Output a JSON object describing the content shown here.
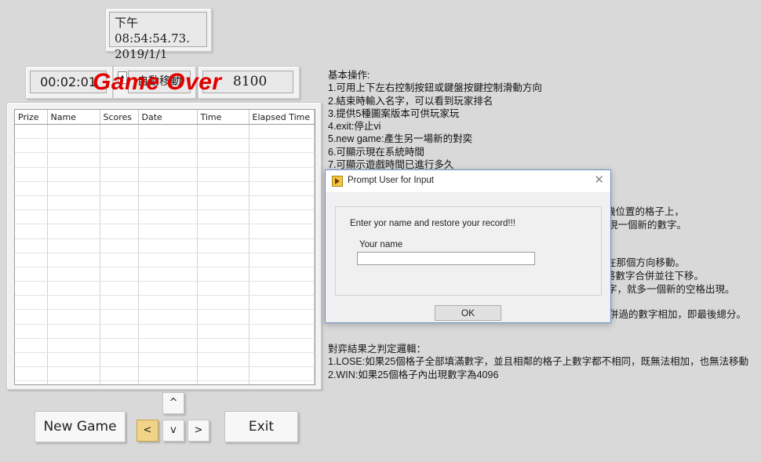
{
  "clock": {
    "time": "下午 08:54:54.73.",
    "date": "2019/1/1"
  },
  "elapsed": "00:02:01",
  "auto_move": {
    "label": "自動移動",
    "spinner": "▴"
  },
  "score": "8100",
  "status_text": "Game Over",
  "leaderboard": {
    "columns": [
      "Prize",
      "Name",
      "Scores",
      "Date",
      "Time",
      "Elapsed Time"
    ],
    "rows": []
  },
  "buttons": {
    "new_game": "New Game",
    "exit": "Exit",
    "up": "^",
    "left": "<",
    "down": "v",
    "right": ">"
  },
  "instructions": {
    "lines": [
      "基本操作:",
      "1.可用上下左右控制按鈕或鍵盤按鍵控制滑動方向",
      "2.結束時輸入名字，可以看到玩家排名",
      "3.提供5種圖案版本可供玩家玩",
      "4.exit:停止vi",
      "5.new game:產生另一場新的對奕",
      "6.可顯示現在系統時間",
      "7.可顯示遊戲時間已進行多久"
    ],
    "partial": [
      "機位置的格子上，",
      "現一個新的數字。",
      "在那個方向移動。",
      "將數字合併並往下移。",
      "字，就多一個新的空格出現。",
      "併過的數字相加，即最後總分。"
    ],
    "bottom": [
      "對弈結果之判定邏輯：",
      "1.LOSE:如果25個格子全部填滿數字，並且相鄰的格子上數字都不相同，既無法相加，也無法移動",
      "2.WIN:如果25個格子內出現數字為4096"
    ]
  },
  "dialog": {
    "title": "Prompt User for Input",
    "close": "✕",
    "message": "Enter yor name and restore your record!!!",
    "field_label": "Your name",
    "field_value": "",
    "ok": "OK"
  }
}
